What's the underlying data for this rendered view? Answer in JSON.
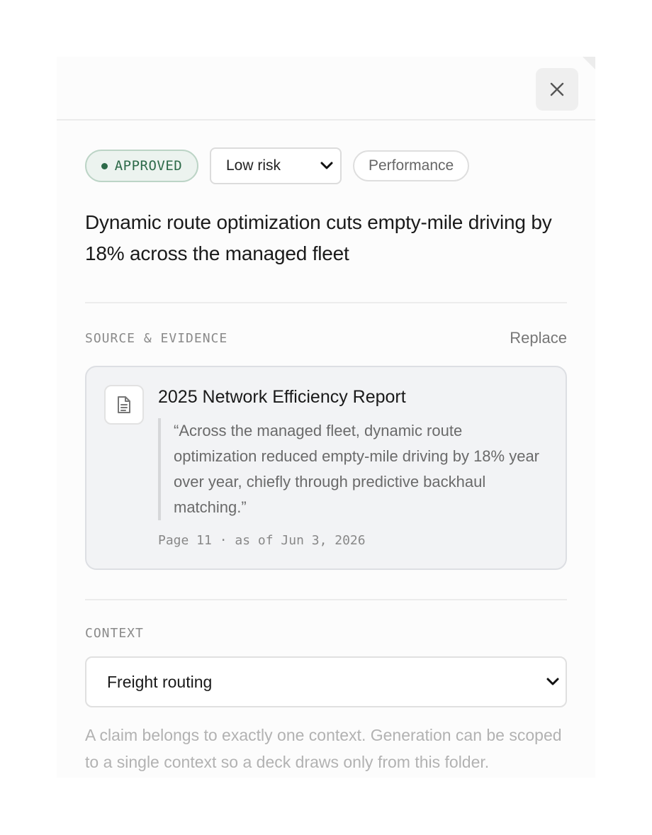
{
  "header": {
    "close_label": "×"
  },
  "claim": {
    "status": "APPROVED",
    "risk": "Low risk",
    "category": "Performance",
    "title": "Dynamic route optimization cuts empty-mile driving by 18% across the managed fleet"
  },
  "source": {
    "section_label": "SOURCE & EVIDENCE",
    "replace_label": "Replace",
    "title": "2025 Network Efficiency Report",
    "quote": "“Across the managed fleet, dynamic route optimization reduced empty-mile driving by 18% year over year, chiefly through predictive backhaul matching.”",
    "meta": "Page 11 · as of Jun 3, 2026"
  },
  "context": {
    "section_label": "CONTEXT",
    "selected": "Freight routing",
    "helper": "A claim belongs to exactly one context. Generation can be scoped to a single context so a deck draws only from this folder."
  },
  "colors": {
    "approved_green": "#2d6a49",
    "approved_bg": "#ecf3ef",
    "card_bg": "#f2f3f5"
  },
  "icons": {
    "close": "close-icon",
    "document": "document-icon",
    "chevron": "chevron-down-icon"
  }
}
